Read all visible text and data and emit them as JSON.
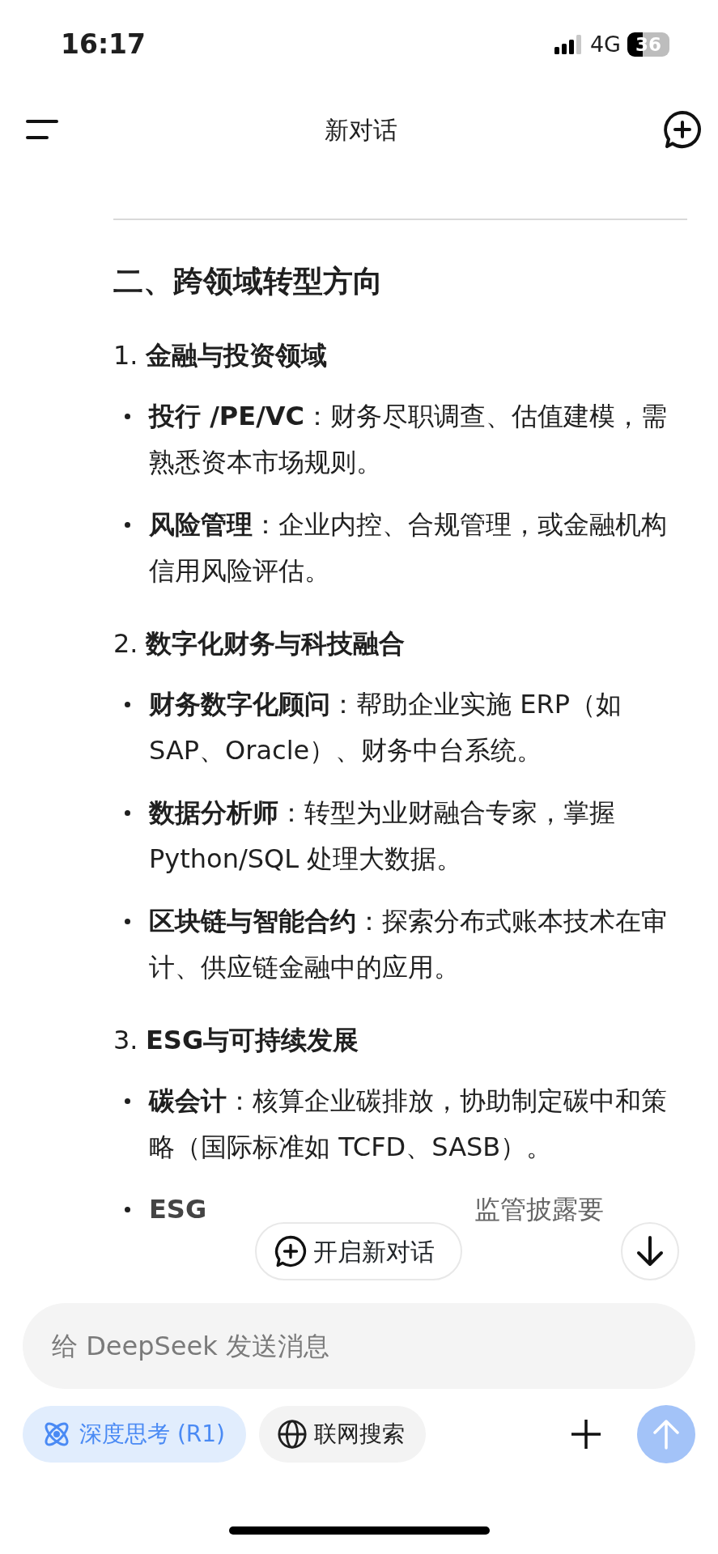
{
  "status_bar": {
    "time": "16:17",
    "network": "4G",
    "battery": "36"
  },
  "header": {
    "title": "新对话"
  },
  "content": {
    "heading": "二、跨领域转型方向",
    "sections": [
      {
        "number": "1.",
        "title": "金融与投资领域",
        "items": [
          {
            "kind": "full",
            "term": "投行 /PE/VC",
            "text": "：财务尽职调查、估值建模，需熟悉资本市场规则。"
          },
          {
            "kind": "full",
            "term": "风险管理",
            "text": "：企业内控、合规管理，或金融机构信用风险评估。"
          }
        ]
      },
      {
        "number": "2.",
        "title": "数字化财务与科技融合",
        "items": [
          {
            "kind": "full",
            "term": "财务数字化顾问",
            "text": "：帮助企业实施 ERP（如 SAP、Oracle）、财务中台系统。"
          },
          {
            "kind": "full",
            "term": "数据分析师",
            "text": "：转型为业财融合专家，掌握 Python/SQL 处理大数据。"
          },
          {
            "kind": "full",
            "term": "区块链与智能合约",
            "text": "：探索分布式账本技术在审计、供应链金融中的应用。"
          }
        ]
      },
      {
        "number": "3.",
        "title": "ESG与可持续发展",
        "items": [
          {
            "kind": "full",
            "term": "碳会计",
            "text": "：核算企业碳排放，协助制定碳中和策略（国际标准如 TCFD、SASB）。"
          },
          {
            "kind": "covered",
            "term": "ESG",
            "text": "监管披露要"
          }
        ]
      }
    ]
  },
  "floating": {
    "new_chat": "开启新对话"
  },
  "composer": {
    "placeholder": "给 DeepSeek 发送消息",
    "options": [
      {
        "label": "深度思考 (R1)",
        "selected": true
      },
      {
        "label": "联网搜索",
        "selected": false
      }
    ],
    "send": {
      "disabled": true
    }
  }
}
